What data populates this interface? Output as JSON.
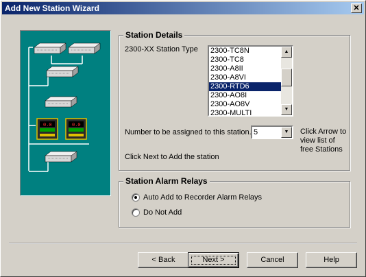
{
  "window": {
    "title": "Add New Station Wizard",
    "close_glyph": "✕"
  },
  "station_details": {
    "legend": "Station Details",
    "type_label": "2300-XX Station Type",
    "station_types": [
      "2300-TC8N",
      "2300-TC8",
      "2300-A8II",
      "2300-A8VI",
      "2300-RTD6",
      "2300-AO8I",
      "2300-AO8V",
      "2300-MULTI"
    ],
    "selected_type": "2300-RTD6",
    "number_label": "Number to be assigned to this station.",
    "number_value": "5",
    "hint": "Click Arrow to view list of free Stations",
    "next_hint": "Click Next to Add the station"
  },
  "alarm_relays": {
    "legend": "Station Alarm Relays",
    "options": [
      {
        "label": "Auto Add to Recorder Alarm Relays",
        "checked": true
      },
      {
        "label": "Do Not Add",
        "checked": false
      }
    ]
  },
  "buttons": {
    "back": "< Back",
    "next": "Next >",
    "cancel": "Cancel",
    "help": "Help"
  },
  "icons": {
    "scroll_up": "▲",
    "scroll_down": "▼",
    "dropdown": "▼"
  },
  "colors": {
    "graphic_bg": "#008080",
    "selection": "#0a246a",
    "titlebar": "#0a246a"
  }
}
